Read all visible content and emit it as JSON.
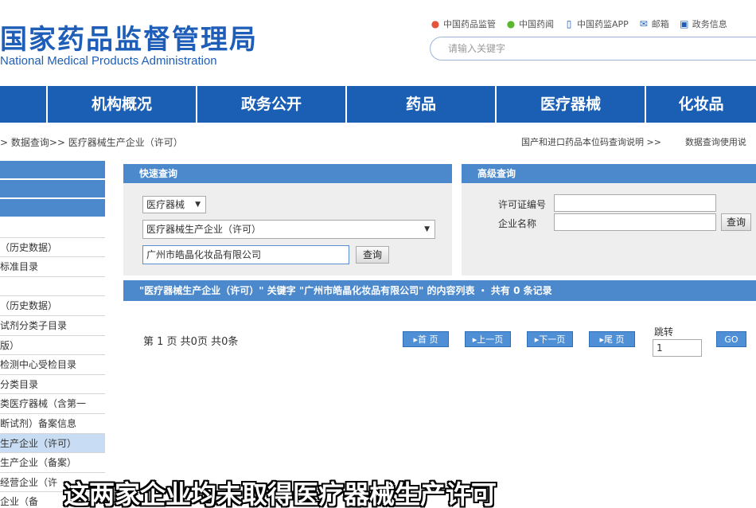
{
  "header": {
    "title_cn": "国家药品监督管理局",
    "title_en": "National Medical Products Administration",
    "top_links": [
      {
        "icon": "weibo-icon",
        "label": "中国药品监管"
      },
      {
        "icon": "wechat-icon",
        "label": "中国药闻"
      },
      {
        "icon": "phone-icon",
        "label": "中国药监APP"
      },
      {
        "icon": "mail-icon",
        "label": "邮箱"
      },
      {
        "icon": "info-icon",
        "label": "政务信息"
      }
    ],
    "search_placeholder": "请输入关键字"
  },
  "nav": [
    "",
    "机构概况",
    "政务公开",
    "药品",
    "医疗器械",
    "化妆品"
  ],
  "breadcrumb": {
    "left": "> 数据查询>> 医疗器械生产企业（许可）",
    "right": [
      "国产和进口药品本位码查询说明 >>",
      "数据查询使用说"
    ]
  },
  "sidebar": {
    "items": [
      "",
      "（历史数据）",
      "标准目录",
      "",
      "（历史数据）",
      "试剂分类子目录",
      "版）",
      "检测中心受检目录",
      "分类目录",
      "类医疗器械（含第一",
      "断试剂）备案信息",
      "生产企业（许可）",
      "生产企业（备案）",
      "经营企业（许",
      "企业（备"
    ],
    "active_index": 11
  },
  "quick_search": {
    "title": "快速查询",
    "category": "医疗器械",
    "database": "医疗器械生产企业（许可）",
    "keyword": "广州市皓晶化妆品有限公司",
    "search_button": "查询"
  },
  "advanced_search": {
    "title": "高级查询",
    "license_label": "许可证编号",
    "company_label": "企业名称",
    "search_button": "查询"
  },
  "results": {
    "summary": "\"医疗器械生产企业（许可）\" 关键字 \"广州市皓晶化妆品有限公司\" 的内容列表 ・ 共有 0 条记录",
    "page_info": "第 1 页 共0页 共0条",
    "buttons": [
      "首 页",
      "上一页",
      "下一页",
      "尾 页"
    ],
    "jump_label": "跳转",
    "jump_value": "1",
    "go_button": "GO"
  },
  "subtitle": "这两家企业均未取得医疗器械生产许可",
  "colors": {
    "brand_blue": "#1a5fb4",
    "panel_blue": "#4b88cc",
    "button_blue": "#4e8fd6"
  }
}
